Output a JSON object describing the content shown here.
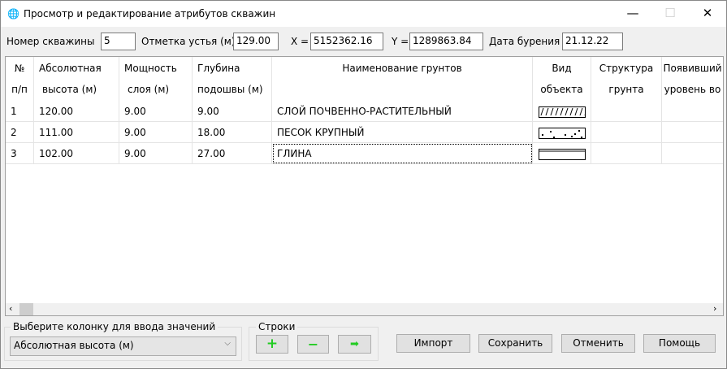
{
  "window": {
    "title": "Просмотр и редактирование атрибутов скважин",
    "minimize": "—",
    "maximize": "☐",
    "close": "✕"
  },
  "header": {
    "well_label": "Номер скважины",
    "well_value": "5",
    "elev_label": "Отметка устья (м)",
    "elev_value": "129.00",
    "x_label": "X =",
    "x_value": "5152362.16",
    "y_label": "Y =",
    "y_value": "1289863.84",
    "date_label": "Дата бурения",
    "date_value": "21.12.22"
  },
  "table": {
    "columns": [
      [
        "№",
        "п/п"
      ],
      [
        "Абсолютная",
        "высота (м)"
      ],
      [
        "Мощность",
        "слоя (м)"
      ],
      [
        "Глубина",
        "подошвы (м)"
      ],
      [
        "Наименование грунтов",
        ""
      ],
      [
        "Вид",
        "объекта"
      ],
      [
        "Структура",
        "грунта"
      ],
      [
        "Появивший",
        "уровень во"
      ]
    ],
    "rows": [
      {
        "n": "1",
        "abs": "120.00",
        "thick": "9.00",
        "depth": "9.00",
        "name": "СЛОЙ ПОЧВЕННО-РАСТИТЕЛЬНЫЙ",
        "pattern": "soil-hatch"
      },
      {
        "n": "2",
        "abs": "111.00",
        "thick": "9.00",
        "depth": "18.00",
        "name": "ПЕСОК КРУПНЫЙ",
        "pattern": "sand-dots"
      },
      {
        "n": "3",
        "abs": "102.00",
        "thick": "9.00",
        "depth": "27.00",
        "name": "ГЛИНА",
        "pattern": "clay-lines"
      }
    ]
  },
  "column_select": {
    "group_label": "Выберите колонку для ввода значений",
    "value": "Абсолютная высота (м)"
  },
  "rows_group": {
    "label": "Строки"
  },
  "buttons": {
    "import": "Импорт",
    "save": "Сохранить",
    "cancel": "Отменить",
    "help": "Помощь"
  },
  "colors": {
    "green_icon": "#22cc22"
  }
}
